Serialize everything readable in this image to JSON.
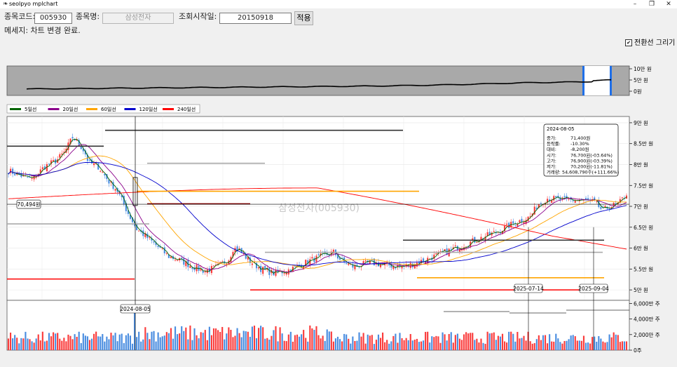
{
  "window": {
    "title": "seolpyo mplchart",
    "minimize": "–",
    "maximize": "❐",
    "close": "✕"
  },
  "form": {
    "code_label": "종목코드:",
    "code_value": "005930",
    "name_label": "종목명:",
    "name_value": "삼성전자",
    "start_label": "조회시작일:",
    "start_value": "20150918",
    "apply_label": "적용",
    "message": "메세지: 차트 변경 완료.",
    "transition_label": "전환선 그리기",
    "transition_checked": true
  },
  "colors": {
    "ma5": "#006400",
    "ma20": "#8b008b",
    "ma60": "#ffa500",
    "ma120": "#0000cd",
    "ma240": "#ff0000",
    "up": "#fa3c3c",
    "down": "#4a8de0"
  },
  "chart_data": {
    "type": "candlestick",
    "watermark": "삼성전자(005930)",
    "legend": [
      {
        "name": "5일선",
        "color": "#006400"
      },
      {
        "name": "20일선",
        "color": "#8b008b"
      },
      {
        "name": "60일선",
        "color": "#ffa500"
      },
      {
        "name": "120일선",
        "color": "#0000cd"
      },
      {
        "name": "240일선",
        "color": "#ff0000"
      }
    ],
    "overview_ticks": [
      "10만 원",
      "5만 원",
      "0원"
    ],
    "price_ticks": [
      "9만 원",
      "8.5만 원",
      "8만 원",
      "7.5만 원",
      "7만 원",
      "6.5만 원",
      "6만 원",
      "5.5만 원",
      "5만 원"
    ],
    "price_tick_values": [
      90000,
      85000,
      80000,
      75000,
      70000,
      65000,
      60000,
      55000,
      50000
    ],
    "volume_ticks": [
      "6,000만 주",
      "4,000만 주",
      "2,000만 주",
      "0주"
    ],
    "volume_tick_values": [
      60000000,
      40000000,
      20000000,
      0
    ],
    "crosshair_price_label": "70,494원",
    "crosshair_date_label": "2024-08-05",
    "date_markers": [
      "2025-07-14",
      "2025-09-04"
    ],
    "info_box": {
      "date": "2024-08-05",
      "rows": [
        {
          "k": "종가",
          "v": "71,400원"
        },
        {
          "k": "등락률",
          "v": "-10.30%"
        },
        {
          "k": "대비",
          "v": "-8,200원"
        },
        {
          "k": "시가",
          "v": "76,700원(-03.64%)"
        },
        {
          "k": "고가",
          "v": "76,900원(-03.39%)"
        },
        {
          "k": "저가",
          "v": "70,200원(-11.81%)"
        },
        {
          "k": "거래량",
          "v": "54,608,790주(+111.66%)"
        }
      ]
    }
  }
}
